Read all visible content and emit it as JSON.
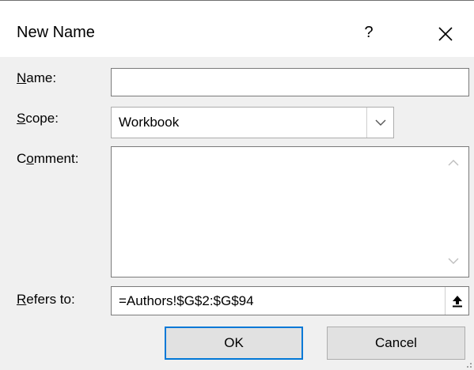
{
  "dialog": {
    "title": "New Name",
    "help_label": "?"
  },
  "form": {
    "name": {
      "label_key": "N",
      "label_rest": "ame:",
      "value": ""
    },
    "scope": {
      "label_key": "S",
      "label_rest": "cope:",
      "value": "Workbook"
    },
    "comment": {
      "label_pre": "C",
      "label_key": "o",
      "label_rest": "mment:",
      "value": ""
    },
    "refers_to": {
      "label_key": "R",
      "label_rest": "efers to:",
      "value": "=Authors!$G$2:$G$94"
    }
  },
  "buttons": {
    "ok_label": "OK",
    "cancel_label": "Cancel"
  },
  "icons": {
    "close": "close-icon",
    "dropdown": "chevron-down-icon",
    "scroll_up": "chevron-up-icon",
    "scroll_down": "chevron-down-icon",
    "collapse": "collapse-dialog-icon"
  },
  "colors": {
    "accent": "#0078d7",
    "dialog_bg": "#f0f0f0",
    "button_bg": "#e1e1e1"
  }
}
